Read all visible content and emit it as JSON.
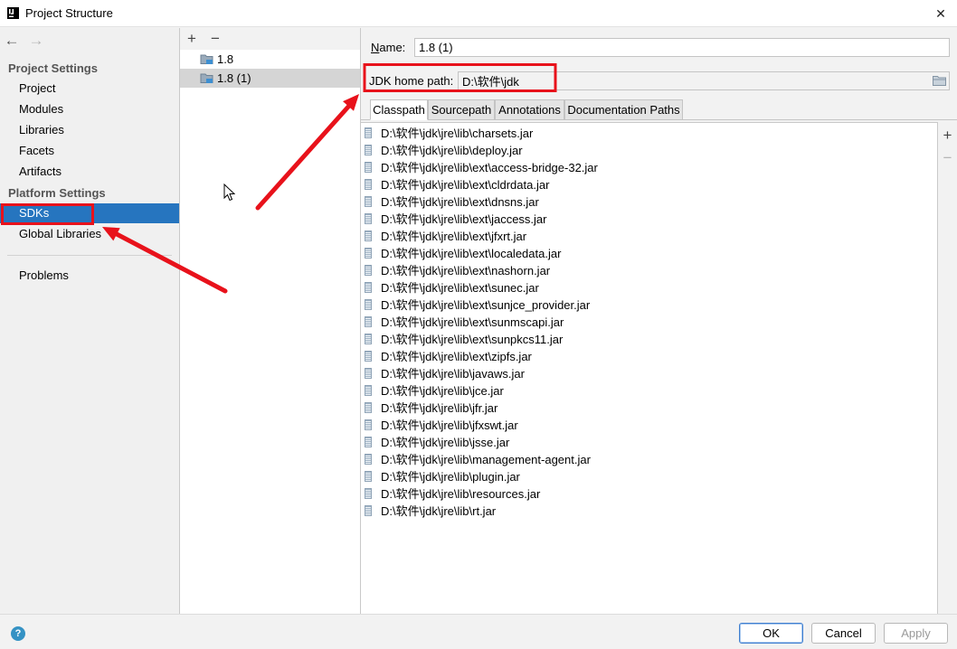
{
  "window": {
    "title": "Project Structure",
    "close_glyph": "✕"
  },
  "nav": {
    "back_glyph": "←",
    "forward_glyph": "→"
  },
  "sidebar": {
    "project_settings_heading": "Project Settings",
    "project_items": [
      {
        "label": "Project"
      },
      {
        "label": "Modules"
      },
      {
        "label": "Libraries"
      },
      {
        "label": "Facets"
      },
      {
        "label": "Artifacts"
      }
    ],
    "platform_settings_heading": "Platform Settings",
    "platform_items": [
      {
        "label": "SDKs",
        "selected": true
      },
      {
        "label": "Global Libraries",
        "selected": false
      }
    ],
    "problems_label": "Problems"
  },
  "sdk_list": {
    "add_glyph": "+",
    "remove_glyph": "−",
    "items": [
      {
        "label": "1.8",
        "selected": false
      },
      {
        "label": "1.8 (1)",
        "selected": true
      }
    ]
  },
  "sdk_detail": {
    "name_label": "Name:",
    "name_value": "1.8 (1)",
    "jdk_home_label": "JDK home path:",
    "jdk_home_value": "D:\\软件\\jdk",
    "tabs": [
      {
        "label": "Classpath",
        "selected": true
      },
      {
        "label": "Sourcepath",
        "selected": false
      },
      {
        "label": "Annotations",
        "selected": false
      },
      {
        "label": "Documentation Paths",
        "selected": false
      }
    ],
    "paths_toolbar": {
      "add_glyph": "+",
      "remove_glyph": "−"
    },
    "classpath_entries": [
      "D:\\软件\\jdk\\jre\\lib\\charsets.jar",
      "D:\\软件\\jdk\\jre\\lib\\deploy.jar",
      "D:\\软件\\jdk\\jre\\lib\\ext\\access-bridge-32.jar",
      "D:\\软件\\jdk\\jre\\lib\\ext\\cldrdata.jar",
      "D:\\软件\\jdk\\jre\\lib\\ext\\dnsns.jar",
      "D:\\软件\\jdk\\jre\\lib\\ext\\jaccess.jar",
      "D:\\软件\\jdk\\jre\\lib\\ext\\jfxrt.jar",
      "D:\\软件\\jdk\\jre\\lib\\ext\\localedata.jar",
      "D:\\软件\\jdk\\jre\\lib\\ext\\nashorn.jar",
      "D:\\软件\\jdk\\jre\\lib\\ext\\sunec.jar",
      "D:\\软件\\jdk\\jre\\lib\\ext\\sunjce_provider.jar",
      "D:\\软件\\jdk\\jre\\lib\\ext\\sunmscapi.jar",
      "D:\\软件\\jdk\\jre\\lib\\ext\\sunpkcs11.jar",
      "D:\\软件\\jdk\\jre\\lib\\ext\\zipfs.jar",
      "D:\\软件\\jdk\\jre\\lib\\javaws.jar",
      "D:\\软件\\jdk\\jre\\lib\\jce.jar",
      "D:\\软件\\jdk\\jre\\lib\\jfr.jar",
      "D:\\软件\\jdk\\jre\\lib\\jfxswt.jar",
      "D:\\软件\\jdk\\jre\\lib\\jsse.jar",
      "D:\\软件\\jdk\\jre\\lib\\management-agent.jar",
      "D:\\软件\\jdk\\jre\\lib\\plugin.jar",
      "D:\\软件\\jdk\\jre\\lib\\resources.jar",
      "D:\\软件\\jdk\\jre\\lib\\rt.jar"
    ]
  },
  "footer": {
    "help_glyph": "?",
    "ok_label": "OK",
    "cancel_label": "Cancel",
    "apply_label": "Apply"
  },
  "colors": {
    "selection_blue": "#2675bf",
    "list_selection_gray": "#d5d5d5",
    "annotation_red": "#e8121b",
    "help_blue": "#3592c4",
    "default_button_border": "#3f7fd0"
  },
  "icons": {
    "app": "intellij-logo-icon",
    "back": "arrow-left-icon",
    "forward": "arrow-right-icon",
    "close": "close-icon",
    "sdk": "sdk-folder-icon",
    "browse": "folder-browse-icon",
    "classpath_entry": "jar-file-icon",
    "add": "plus-icon",
    "remove": "minus-icon",
    "help": "help-icon",
    "cursor": "mouse-cursor-icon"
  }
}
